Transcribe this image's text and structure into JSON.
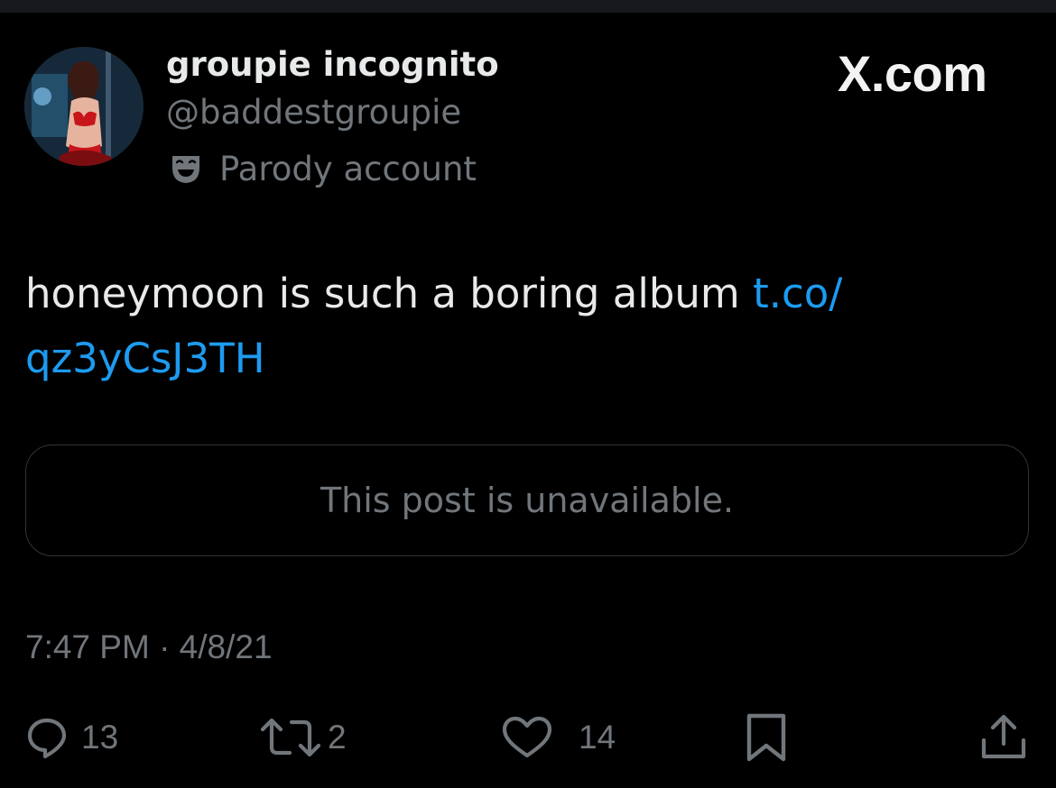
{
  "user": {
    "display_name": "groupie incognito",
    "handle": "@baddestgroupie",
    "badge_label": "Parody account",
    "badge_icon": "theater-mask-icon"
  },
  "brand": {
    "label": "X.com"
  },
  "post": {
    "text": "honeymoon is such a boring album ",
    "link_part1": "t.co/",
    "link_part2": "qz3yCsJ3TH",
    "quoted_post_notice": "This post is unavailable.",
    "timestamp": "7:47 PM · 4/8/21"
  },
  "actions": {
    "replies": "13",
    "reposts": "2",
    "likes": "14"
  },
  "colors": {
    "background": "#000000",
    "text": "#e7e9ea",
    "muted": "#71767b",
    "link": "#1d9bf0",
    "border": "#2f3336"
  }
}
